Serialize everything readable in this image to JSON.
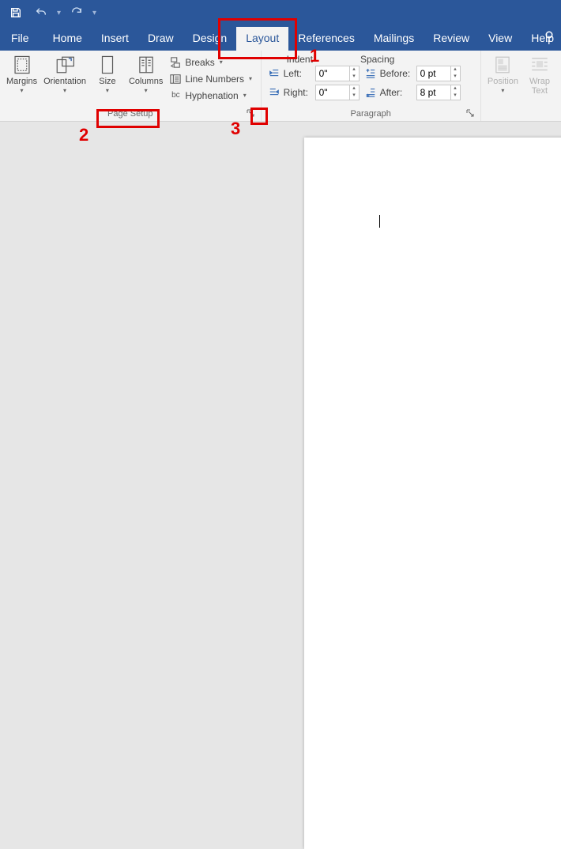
{
  "quickAccess": {
    "customizeChevron": "▾"
  },
  "tabs": {
    "file": "File",
    "home": "Home",
    "insert": "Insert",
    "draw": "Draw",
    "design": "Design",
    "layout": "Layout",
    "references": "References",
    "mailings": "Mailings",
    "review": "Review",
    "view": "View",
    "help": "Help"
  },
  "pageSetup": {
    "margins": "Margins",
    "orientation": "Orientation",
    "size": "Size",
    "columns": "Columns",
    "breaks": "Breaks",
    "lineNumbers": "Line Numbers",
    "hyphenation": "Hyphenation",
    "groupLabel": "Page Setup"
  },
  "paragraph": {
    "indentHeader": "Indent",
    "spacingHeader": "Spacing",
    "left": "Left:",
    "right": "Right:",
    "before": "Before:",
    "after": "After:",
    "leftVal": "0\"",
    "rightVal": "0\"",
    "beforeVal": "0 pt",
    "afterVal": "8 pt",
    "groupLabel": "Paragraph"
  },
  "arrange": {
    "position": "Position",
    "wrapText": "Wrap\nText"
  },
  "annotations": {
    "n1": "1",
    "n2": "2",
    "n3": "3"
  }
}
